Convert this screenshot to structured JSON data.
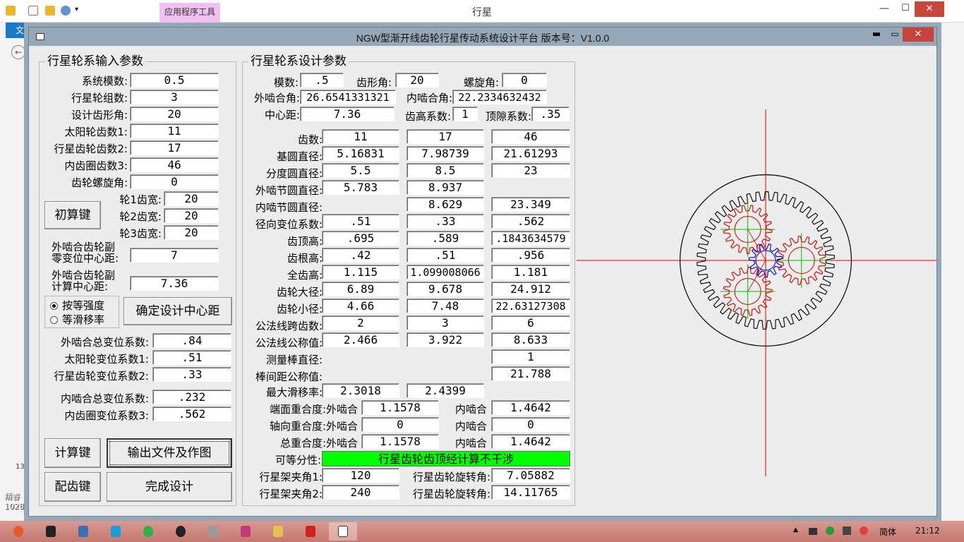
{
  "background_window": {
    "title": "行星",
    "context_tab": "应用程序工具",
    "file_tab": "文件",
    "side_label": "13",
    "desktop_label": [
      "精睿",
      "1028"
    ]
  },
  "main_window": {
    "title": "NGW型渐开线齿轮行星传动系统设计平台  版本号：V1.0.0",
    "min_symbol": "▬",
    "max_symbol": "▭",
    "close_symbol": "✕"
  },
  "input_group": {
    "title": "行星轮系输入参数",
    "fields": [
      {
        "label": "系统模数:",
        "value": "0.5"
      },
      {
        "label": "行星轮组数:",
        "value": "3"
      },
      {
        "label": "设计齿形角:",
        "value": "20"
      },
      {
        "label": "太阳轮齿数1:",
        "value": "11"
      },
      {
        "label": "行星齿轮齿数2:",
        "value": "17"
      },
      {
        "label": "内齿圈齿数3:",
        "value": "46"
      },
      {
        "label": "齿轮螺旋角:",
        "value": "0"
      }
    ],
    "initial_calc_button": "初算键",
    "face_widths": [
      {
        "label": "轮1齿宽:",
        "value": "20"
      },
      {
        "label": "轮2齿宽:",
        "value": "20"
      },
      {
        "label": "轮3齿宽:",
        "value": "20"
      }
    ],
    "zero_shift_label_1": "外啮合齿轮副",
    "zero_shift_label_2": "零变位中心距:",
    "zero_shift_value": "7",
    "calc_center_label_1": "外啮合齿轮副",
    "calc_center_label_2": "计算中心距:",
    "calc_center_value": "7.36",
    "radio_equal_strength": "按等强度",
    "radio_equal_sliding": "等滑移率",
    "confirm_center_button": "确定设计中心距",
    "shift_fields": [
      {
        "label": "外啮合总变位系数:",
        "value": ".84"
      },
      {
        "label": "太阳轮变位系数1:",
        "value": ".51"
      },
      {
        "label": "行星齿轮变位系数2:",
        "value": ".33"
      },
      {
        "label": "内啮合总变位系数:",
        "value": ".232"
      },
      {
        "label": "内齿圈变位系数3:",
        "value": ".562"
      }
    ],
    "calc_button": "计算键",
    "export_button": "输出文件及作图",
    "match_teeth_button": "配齿键",
    "finish_button": "完成设计"
  },
  "design_group": {
    "title": "行星轮系设计参数",
    "module_label": "模数:",
    "module_value": ".5",
    "pressure_angle_label": "齿形角:",
    "pressure_angle_value": "20",
    "helix_angle_label": "螺旋角:",
    "helix_angle_value": "0",
    "ext_mesh_angle_label": "外啮合角:",
    "ext_mesh_angle_value": "26.6541331321",
    "int_mesh_angle_label": "内啮合角:",
    "int_mesh_angle_value": "22.2334632432",
    "center_distance_label": "中心距:",
    "center_distance_value": "7.36",
    "addendum_coef_label": "齿高系数:",
    "addendum_coef_value": "1",
    "clearance_coef_label": "顶隙系数:",
    "clearance_coef_value": ".35",
    "rows": [
      {
        "label": "齿数:",
        "values": [
          "11",
          "17",
          "46"
        ]
      },
      {
        "label": "基圆直径:",
        "values": [
          "5.16831",
          "7.98739",
          "21.61293"
        ]
      },
      {
        "label": "分度圆直径:",
        "values": [
          "5.5",
          "8.5",
          "23"
        ]
      },
      {
        "label": "外啮节圆直径:",
        "values": [
          "5.783",
          "8.937",
          ""
        ]
      },
      {
        "label": "内啮节圆直径:",
        "values": [
          "",
          "8.629",
          "23.349"
        ]
      },
      {
        "label": "径向变位系数:",
        "values": [
          ".51",
          ".33",
          ".562"
        ]
      },
      {
        "label": "齿顶高:",
        "values": [
          ".695",
          ".589",
          ".1843634579"
        ]
      },
      {
        "label": "齿根高:",
        "values": [
          ".42",
          ".51",
          ".956"
        ]
      },
      {
        "label": "全齿高:",
        "values": [
          "1.115",
          "1.099008066",
          "1.181"
        ]
      },
      {
        "label": "齿轮大径:",
        "values": [
          "6.89",
          "9.678",
          "24.912"
        ]
      },
      {
        "label": "齿轮小径:",
        "values": [
          "4.66",
          "7.48",
          "22.63127308"
        ]
      },
      {
        "label": "公法线跨齿数:",
        "values": [
          "2",
          "3",
          "6"
        ]
      },
      {
        "label": "公法线公称值:",
        "values": [
          "2.466",
          "3.922",
          "8.633"
        ]
      },
      {
        "label": "测量棒直径:",
        "values": [
          "",
          "",
          "1"
        ]
      },
      {
        "label": "棒间距公称值:",
        "values": [
          "",
          "",
          "21.788"
        ]
      }
    ],
    "max_slip_label": "最大滑移率:",
    "max_slip_values": [
      "2.3018",
      "2.4399"
    ],
    "contact_rows": [
      {
        "label": "端面重合度:外啮合",
        "ext": "1.1578",
        "int_label": "内啮合",
        "int": "1.4642"
      },
      {
        "label": "轴向重合度:外啮合",
        "ext": "0",
        "int_label": "内啮合",
        "int": "0"
      },
      {
        "label": "总重合度:外啮合",
        "ext": "1.1578",
        "int_label": "内啮合",
        "int": "1.4642"
      }
    ],
    "equal_division_label": "可等分性:",
    "status_text": "行星齿轮齿顶经计算不干涉",
    "carrier_angle_1_label": "行星架夹角1:",
    "carrier_angle_1_value": "120",
    "carrier_angle_2_label": "行星架夹角2:",
    "carrier_angle_2_value": "240",
    "planet_rot_1_label": "行星齿轮旋转角:",
    "planet_rot_1_value": "7.05882",
    "planet_rot_2_label": "行星齿轮旋转角:",
    "planet_rot_2_value": "14.11765"
  },
  "drawing": {
    "sun_teeth": 11,
    "planet_teeth": 17,
    "ring_teeth": 46,
    "planet_count": 3,
    "colors": {
      "sun": "#0000cc",
      "planet": "#dd0000",
      "ring": "#000000",
      "axes": "#dd0000",
      "planet_axes": "#00c000"
    }
  },
  "taskbar": {
    "language": "简体",
    "clock": "21:12"
  }
}
